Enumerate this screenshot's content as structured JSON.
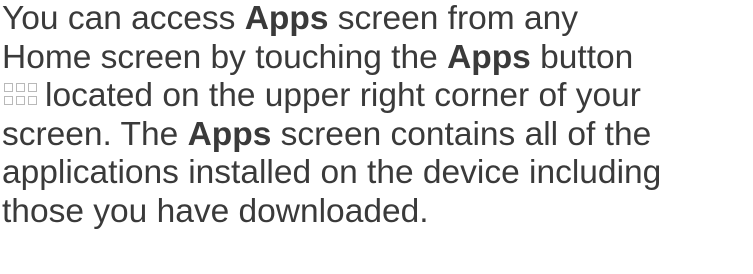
{
  "paragraph": {
    "line1": {
      "pre": "You can access ",
      "bold": "Apps",
      "post": " screen from any"
    },
    "line2": {
      "pre": "Home screen by touching the ",
      "bold": "Apps",
      "post": " button"
    },
    "line3": {
      "icon": "apps-grid-icon",
      "text": "located on the upper right corner of your"
    },
    "line4": {
      "pre": "screen. The ",
      "bold": "Apps",
      "post": " screen contains all of the"
    },
    "line5": {
      "text": "applications installed on the device including"
    },
    "line6": {
      "text": "those you have downloaded."
    }
  }
}
